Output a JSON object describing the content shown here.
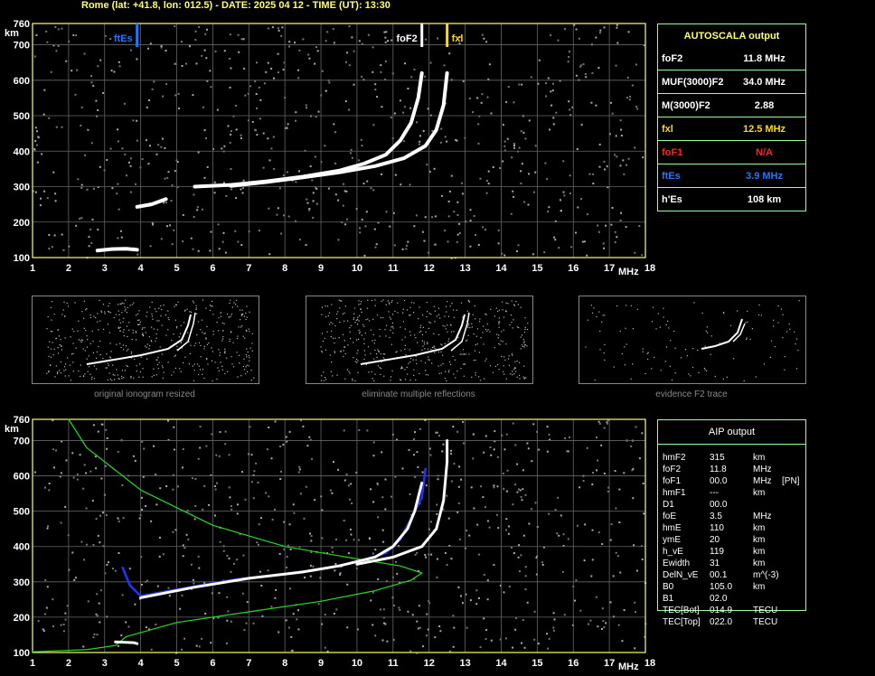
{
  "header": "Rome (lat: +41.8, lon: 012.5) - DATE: 2025 04 12 - TIME (UT): 13:30",
  "colors": {
    "grid": "#666666",
    "frame": "#ffff66",
    "tick_label": "#ffffff",
    "fxl": "#ffdd00",
    "ftEs": "#2277ff",
    "foF1": "#ff2222",
    "aip_green": "#22dd22",
    "aip_blue": "#2233ff"
  },
  "chart_data": [
    {
      "type": "scatter",
      "title": "",
      "xlabel": "MHz",
      "ylabel": "km",
      "xlim": [
        1,
        18
      ],
      "ylim": [
        100,
        760
      ],
      "x_ticks": [
        "1",
        "2",
        "3",
        "4",
        "5",
        "6",
        "7",
        "8",
        "9",
        "10",
        "11",
        "12",
        "13",
        "14",
        "15",
        "16",
        "17",
        "18"
      ],
      "y_ticks": [
        "100",
        "200",
        "300",
        "400",
        "500",
        "600",
        "700",
        "760"
      ],
      "grid": true,
      "markers": [
        {
          "name": "ftEs",
          "x": 3.9
        },
        {
          "name": "foF2",
          "x": 11.8
        },
        {
          "name": "fxl",
          "x": 12.5
        }
      ],
      "series": [
        {
          "name": "O trace",
          "points": [
            [
              5.5,
              300
            ],
            [
              6.5,
              305
            ],
            [
              7.5,
              315
            ],
            [
              8.5,
              328
            ],
            [
              9.5,
              345
            ],
            [
              10.2,
              365
            ],
            [
              10.8,
              390
            ],
            [
              11.2,
              430
            ],
            [
              11.5,
              480
            ],
            [
              11.7,
              550
            ],
            [
              11.8,
              620
            ]
          ]
        },
        {
          "name": "X trace",
          "points": [
            [
              6.5,
              302
            ],
            [
              7.5,
              313
            ],
            [
              8.5,
              326
            ],
            [
              9.5,
              340
            ],
            [
              10.5,
              358
            ],
            [
              11.3,
              380
            ],
            [
              11.9,
              415
            ],
            [
              12.2,
              460
            ],
            [
              12.4,
              530
            ],
            [
              12.5,
              620
            ]
          ]
        },
        {
          "name": "low trace",
          "points": [
            [
              3.9,
              243
            ],
            [
              4.3,
              250
            ],
            [
              4.7,
              265
            ]
          ]
        },
        {
          "name": "Es trace",
          "points": [
            [
              2.8,
              120
            ],
            [
              3.2,
              124
            ],
            [
              3.6,
              125
            ],
            [
              3.9,
              122
            ]
          ]
        }
      ]
    },
    {
      "type": "line",
      "title": "",
      "xlabel": "MHz",
      "ylabel": "km",
      "xlim": [
        1,
        18
      ],
      "ylim": [
        100,
        760
      ],
      "x_ticks": [
        "1",
        "2",
        "3",
        "4",
        "5",
        "6",
        "7",
        "8",
        "9",
        "10",
        "11",
        "12",
        "13",
        "14",
        "15",
        "16",
        "17",
        "18"
      ],
      "y_ticks": [
        "100",
        "200",
        "300",
        "400",
        "500",
        "600",
        "700",
        "760"
      ],
      "grid": true,
      "series": [
        {
          "name": "electron density profile",
          "points": [
            [
              1.0,
              102
            ],
            [
              2.5,
              108
            ],
            [
              3.3,
              120
            ],
            [
              3.6,
              145
            ],
            [
              5.0,
              185
            ],
            [
              7.0,
              215
            ],
            [
              9.0,
              245
            ],
            [
              10.5,
              275
            ],
            [
              11.5,
              305
            ],
            [
              11.8,
              325
            ],
            [
              11.2,
              345
            ],
            [
              10.0,
              365
            ],
            [
              8.0,
              400
            ],
            [
              6.0,
              460
            ],
            [
              4.0,
              560
            ],
            [
              2.5,
              680
            ],
            [
              2.0,
              760
            ]
          ]
        },
        {
          "name": "AIP fitted trace",
          "points": [
            [
              3.5,
              340
            ],
            [
              3.7,
              290
            ],
            [
              4.0,
              260
            ],
            [
              5.0,
              278
            ],
            [
              6.5,
              305
            ],
            [
              8.0,
              322
            ],
            [
              9.0,
              336
            ],
            [
              10.0,
              356
            ],
            [
              10.8,
              382
            ],
            [
              11.2,
              420
            ],
            [
              11.5,
              480
            ],
            [
              11.8,
              540
            ],
            [
              11.9,
              620
            ]
          ]
        },
        {
          "name": "O trace",
          "points": [
            [
              4.0,
              255
            ],
            [
              5.5,
              285
            ],
            [
              7.0,
              310
            ],
            [
              8.5,
              328
            ],
            [
              9.5,
              345
            ],
            [
              10.5,
              370
            ],
            [
              11.0,
              400
            ],
            [
              11.4,
              450
            ],
            [
              11.6,
              500
            ],
            [
              11.8,
              580
            ]
          ]
        },
        {
          "name": "X trace",
          "points": [
            [
              10.0,
              350
            ],
            [
              11.0,
              370
            ],
            [
              11.8,
              400
            ],
            [
              12.2,
              450
            ],
            [
              12.4,
              530
            ],
            [
              12.5,
              640
            ],
            [
              12.5,
              700
            ]
          ]
        },
        {
          "name": "Es trace",
          "points": [
            [
              3.3,
              130
            ],
            [
              3.8,
              128
            ],
            [
              3.9,
              125
            ]
          ]
        }
      ]
    }
  ],
  "autoscala": {
    "title": "AUTOSCALA output",
    "rows": [
      {
        "label": "foF2",
        "value": "11.8 MHz",
        "color": "#ffffff"
      },
      {
        "label": "MUF(3000)F2",
        "value": "34.0 MHz",
        "color": "#ffffff"
      },
      {
        "label": "M(3000)F2",
        "value": "2.88",
        "color": "#ffffff"
      },
      {
        "label": "fxl",
        "value": "12.5 MHz",
        "color": "#ffdd00"
      },
      {
        "label": "foF1",
        "value": "N/A",
        "color": "#ff2222"
      },
      {
        "label": "ftEs",
        "value": "3.9 MHz",
        "color": "#2277ff"
      },
      {
        "label": "h'Es",
        "value": "108    km",
        "color": "#ffffff"
      }
    ]
  },
  "aip": {
    "title": "AIP output",
    "rows": [
      [
        "hmF2",
        "315",
        "km",
        ""
      ],
      [
        "foF2",
        "11.8",
        "MHz",
        ""
      ],
      [
        "foF1",
        "00.0",
        "MHz",
        "[PN]"
      ],
      [
        "hmF1",
        "---",
        "km",
        ""
      ],
      [
        "D1",
        "00.0",
        "",
        ""
      ],
      [
        "foE",
        "3.5",
        "MHz",
        ""
      ],
      [
        "hmE",
        "110",
        "km",
        ""
      ],
      [
        "ymE",
        "20",
        "km",
        ""
      ],
      [
        "h_vE",
        "119",
        "km",
        ""
      ],
      [
        "Ewidth",
        "31",
        "km",
        ""
      ],
      [
        "DelN_vE",
        "00.1",
        "m^(-3)",
        ""
      ],
      [
        "B0",
        "105.0",
        "km",
        ""
      ],
      [
        "B1",
        "02.0",
        "",
        ""
      ],
      [
        "TEC[Bot]",
        "014.9",
        "TECU",
        ""
      ],
      [
        "TEC[Top]",
        "022.0",
        "TECU",
        ""
      ]
    ]
  },
  "thumbnails": [
    {
      "caption": "original ionogram resized"
    },
    {
      "caption": "eliminate multiple reflections"
    },
    {
      "caption": "evidence F2 trace"
    }
  ]
}
